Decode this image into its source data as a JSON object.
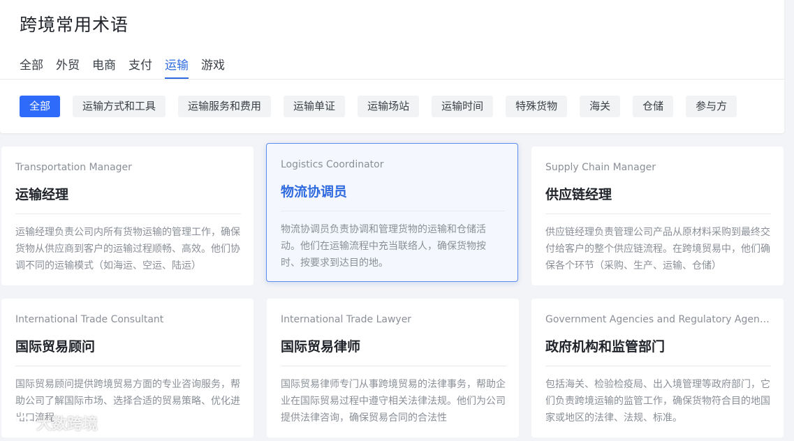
{
  "page": {
    "title": "跨境常用术语"
  },
  "main_tabs": [
    {
      "label": "全部",
      "active": false
    },
    {
      "label": "外贸",
      "active": false
    },
    {
      "label": "电商",
      "active": false
    },
    {
      "label": "支付",
      "active": false
    },
    {
      "label": "运输",
      "active": true
    },
    {
      "label": "游戏",
      "active": false
    }
  ],
  "sub_tabs": [
    {
      "label": "全部",
      "active": true
    },
    {
      "label": "运输方式和工具",
      "active": false
    },
    {
      "label": "运输服务和费用",
      "active": false
    },
    {
      "label": "运输单证",
      "active": false
    },
    {
      "label": "运输场站",
      "active": false
    },
    {
      "label": "运输时间",
      "active": false
    },
    {
      "label": "特殊货物",
      "active": false
    },
    {
      "label": "海关",
      "active": false
    },
    {
      "label": "仓储",
      "active": false
    },
    {
      "label": "参与方",
      "active": false
    }
  ],
  "cards": [
    {
      "en": "Transportation Manager",
      "cn": "运输经理",
      "desc": "运输经理负责公司内所有货物运输的管理工作，确保货物从供应商到客户的运输过程顺畅、高效。他们协调不同的运输模式（如海运、空运、陆运）"
    },
    {
      "en": "Logistics Coordinator",
      "cn": "物流协调员",
      "desc": "物流协调员负责协调和管理货物的运输和仓储活动。他们在运输流程中充当联络人，确保货物按时、按要求到达目的地。",
      "highlighted": true
    },
    {
      "en": "Supply Chain Manager",
      "cn": "供应链经理",
      "desc": "供应链经理负责管理公司产品从原材料采购到最终交付给客户的整个供应链流程。在跨境贸易中，他们确保各个环节（采购、生产、运输、仓储）"
    },
    {
      "en": "International Trade Consultant",
      "cn": "国际贸易顾问",
      "desc": "国际贸易顾问提供跨境贸易方面的专业咨询服务，帮助公司了解国际市场、选择合适的贸易策略、优化进出口流程。"
    },
    {
      "en": "International Trade Lawyer",
      "cn": "国际贸易律师",
      "desc": "国际贸易律师专门从事跨境贸易的法律事务，帮助企业在国际贸易过程中遵守相关法律法规。他们为公司提供法律咨询，确保贸易合同的合法性"
    },
    {
      "en": "Government Agencies and Regulatory Agencies",
      "cn": "政府机构和监管部门",
      "desc": "包括海关、检验检疫局、出入境管理等政府部门，它们负责跨境运输的监管工作，确保货物符合目的地国家或地区的法律、法规、标准。"
    }
  ],
  "watermark": {
    "text": "大数跨境"
  },
  "colors": {
    "accent": "#2f6bdf",
    "active_chip": "#2f6bfa"
  }
}
